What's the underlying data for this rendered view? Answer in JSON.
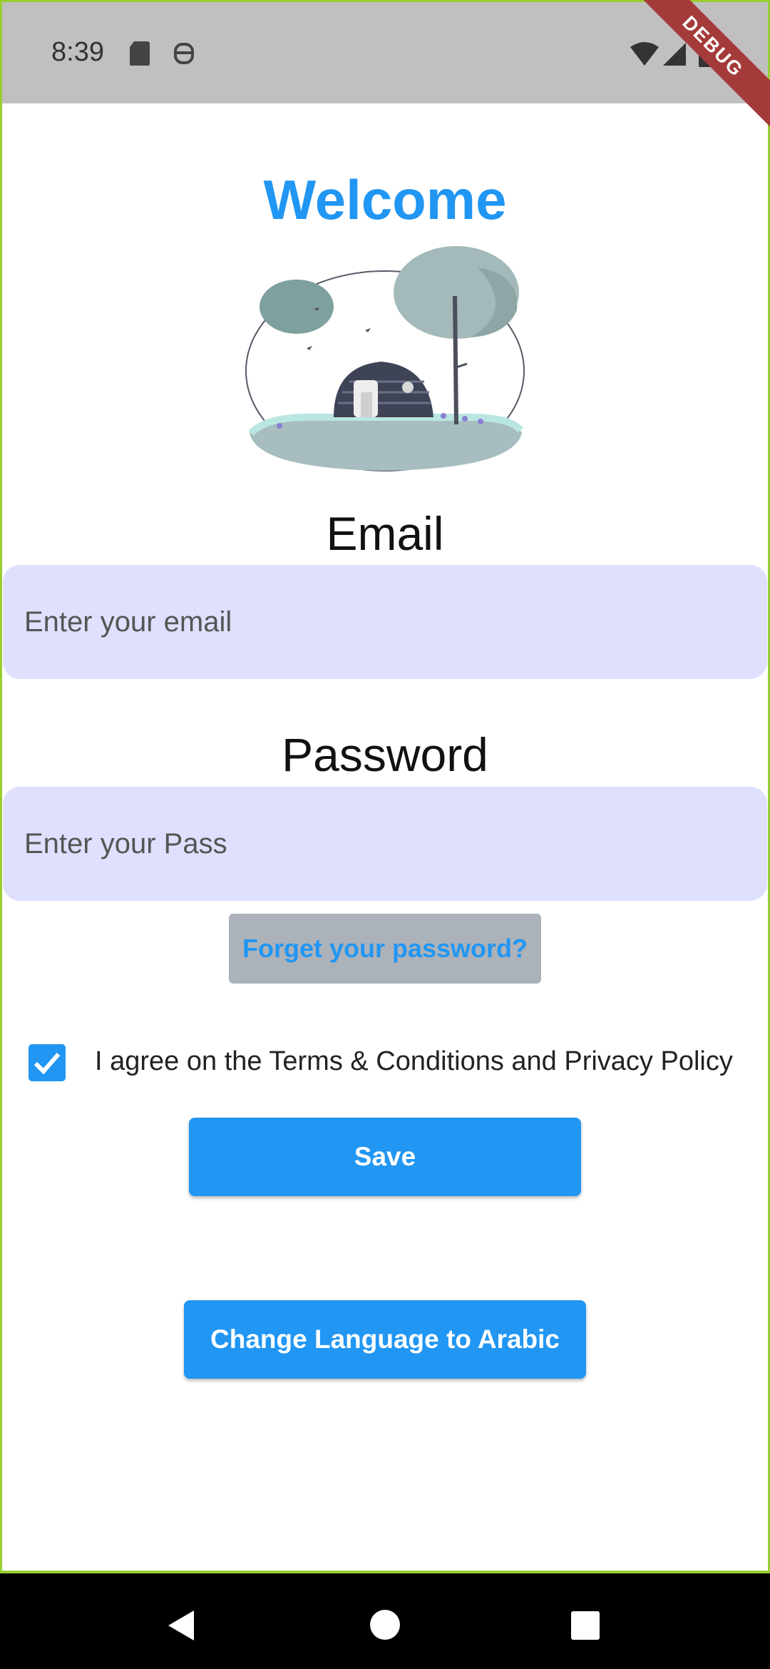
{
  "status_bar": {
    "time": "8:39",
    "left_icons": [
      "sd-card-icon",
      "robot-icon"
    ],
    "right_icons": [
      "wifi-icon",
      "signal-icon",
      "battery-icon"
    ]
  },
  "debug_banner": "DEBUG",
  "header": {
    "title": "Welcome"
  },
  "illustration": {
    "icon": "landscape-illustration"
  },
  "form": {
    "email_label": "Email",
    "email_placeholder": "Enter your email",
    "password_label": "Password",
    "password_placeholder": "Enter your Pass",
    "forgot_label": "Forget your password?",
    "agree_checked": true,
    "agree_text": "I agree on the Terms & Conditions and Privacy Policy",
    "save_label": "Save",
    "language_label": "Change Language to Arabic"
  },
  "colors": {
    "accent": "#2196f3",
    "field_bg": "#dee0fd",
    "forgot_bg": "#acb2b9",
    "frame": "#9acd32",
    "debug": "#a53a3a"
  },
  "nav_bar": {
    "icons": [
      "back-icon",
      "home-icon",
      "recents-icon"
    ]
  }
}
